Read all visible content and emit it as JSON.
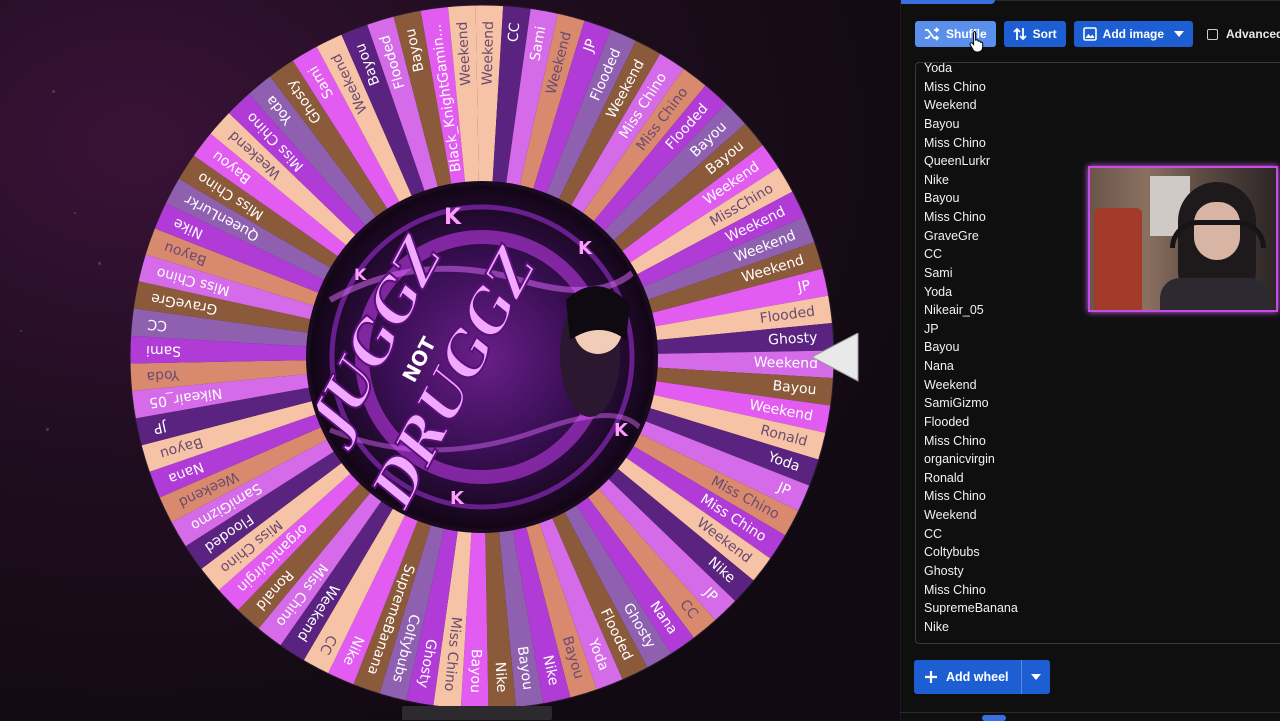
{
  "wheel": {
    "slices_start_angle": -88.8,
    "slices": [
      "Weekend",
      "CC",
      "Sami",
      "Weekend",
      "JP",
      "Flooded",
      "Weekend",
      "Miss Chino",
      "Miss Chino",
      "Flooded",
      "Bayou",
      "Bayou",
      "Weekend",
      "MissChino",
      "Weekend",
      "Weekend",
      "Weekend",
      "JP",
      "Flooded",
      "Ghosty",
      "Weekend",
      "Bayou",
      "Weekend",
      "Ronald",
      "Yoda",
      "JP",
      "Miss Chino",
      "Miss Chino",
      "Weekend",
      "Nike",
      "JP",
      "CC",
      "Nana",
      "Ghosty",
      "Flooded",
      "Yoda",
      "Bayou",
      "Nike",
      "Bayou",
      "Nike",
      "Bayou",
      "Miss Chino",
      "Ghosty",
      "Coltybubs",
      "SupremeBanana",
      "Nike",
      "CC",
      "Weekend",
      "Miss Chino",
      "Ronald",
      "organicvirgin",
      "Miss Chino",
      "Flooded",
      "SamiGizmo",
      "Weekend",
      "Nana",
      "Bayou",
      "JP",
      "Nikeair_05",
      "Yoda",
      "Sami",
      "CC",
      "GraveGre",
      "Miss Chino",
      "Bayou",
      "Nike",
      "QueenLurkr",
      "Miss Chino",
      "Bayou",
      "Weekend",
      "Miss Chino",
      "Yoda",
      "Ghosty",
      "Sami",
      "Weekend",
      "Bayou",
      "Flooded",
      "Bayou",
      "Black_KnightGamin...",
      "Weekend"
    ],
    "palette": [
      "#f7c3a6",
      "#d98a6e",
      "#8a5a3a",
      "#5a2380",
      "#b13bd6",
      "#e35cf2",
      "#d56be8",
      "#9060b0"
    ],
    "center_logo": {
      "line1": "JUGGZ",
      "line2": "NOT",
      "line3": "DRUGGZ",
      "badge": "K"
    },
    "pointer_icon": "triangle-pointer-icon"
  },
  "toolbar": {
    "shuffle_label": "Shuffle",
    "shuffle_icon": "shuffle-icon",
    "sort_label": "Sort",
    "sort_icon": "sort-icon",
    "add_image_label": "Add image",
    "add_image_icon": "image-icon",
    "advanced_label": "Advanced",
    "advanced_checked": false
  },
  "entries": [
    "Yoda",
    "Miss Chino",
    "Weekend",
    "Bayou",
    "Miss Chino",
    "QueenLurkr",
    "Nike",
    "Bayou",
    "Miss Chino",
    "GraveGre",
    "CC",
    "Sami",
    "Yoda",
    "Nikeair_05",
    "JP",
    "Bayou",
    "Nana",
    "Weekend",
    "SamiGizmo",
    "Flooded",
    "Miss Chino",
    "organicvirgin",
    "Ronald",
    "Miss Chino",
    "Weekend",
    "CC",
    "Coltybubs",
    "Ghosty",
    "Miss Chino",
    "SupremeBanana",
    "Nike"
  ],
  "add_wheel": {
    "label": "Add wheel",
    "icon": "plus-icon"
  },
  "colors": {
    "accent": "#1d5fd2",
    "accent_hover": "#5a8fec",
    "panel_bg": "#0f0f10"
  }
}
